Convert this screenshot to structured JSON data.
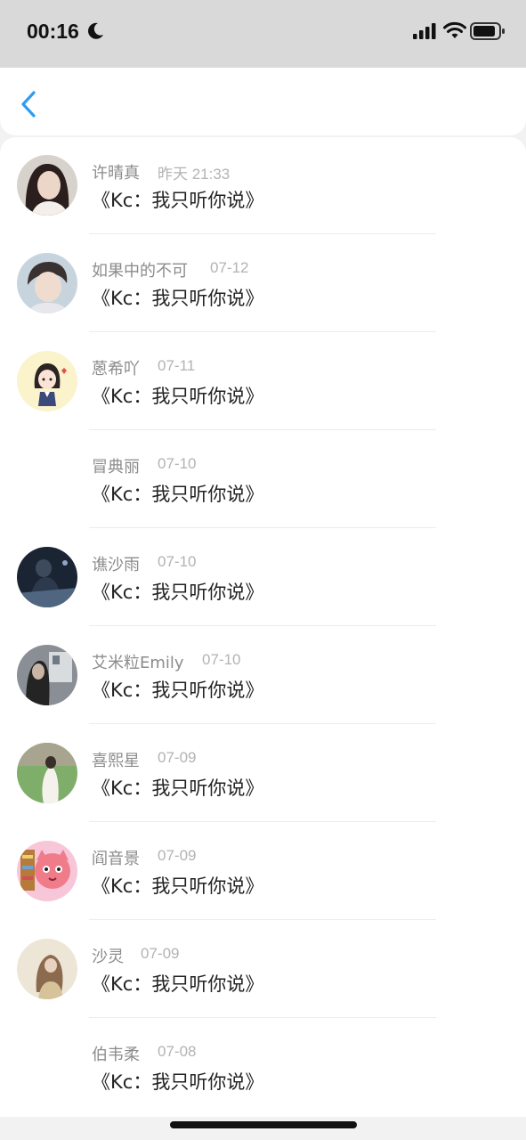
{
  "status_bar": {
    "time": "00:16",
    "moon_icon": "moon-icon",
    "signal_icon": "cellular-signal-icon",
    "wifi_icon": "wifi-icon",
    "battery_icon": "battery-icon"
  },
  "nav": {
    "back_icon": "chevron-left-icon",
    "accent_color": "#2a9df4"
  },
  "items": [
    {
      "name": "许晴真",
      "date": "昨天 21:33",
      "message": "《Kc：我只听你说》",
      "avatar": "photo"
    },
    {
      "name": "如果中的不可",
      "date": "07-12",
      "message": "《Kc：我只听你说》",
      "avatar": "photo"
    },
    {
      "name": "蒽希吖",
      "date": "07-11",
      "message": "《Kc：我只听你说》",
      "avatar": "cartoon"
    },
    {
      "name": "冒典丽",
      "date": "07-10",
      "message": "《Kc：我只听你说》",
      "avatar": "none"
    },
    {
      "name": "谯沙雨",
      "date": "07-10",
      "message": "《Kc：我只听你说》",
      "avatar": "photo"
    },
    {
      "name": "艾米粒Emily",
      "date": "07-10",
      "message": "《Kc：我只听你说》",
      "avatar": "photo"
    },
    {
      "name": "喜熙星",
      "date": "07-09",
      "message": "《Kc：我只听你说》",
      "avatar": "photo"
    },
    {
      "name": "阎音景",
      "date": "07-09",
      "message": "《Kc：我只听你说》",
      "avatar": "cartoon"
    },
    {
      "name": "沙灵",
      "date": "07-09",
      "message": "《Kc：我只听你说》",
      "avatar": "photo"
    },
    {
      "name": "伯韦柔",
      "date": "07-08",
      "message": "《Kc：我只听你说》",
      "avatar": "none"
    }
  ]
}
